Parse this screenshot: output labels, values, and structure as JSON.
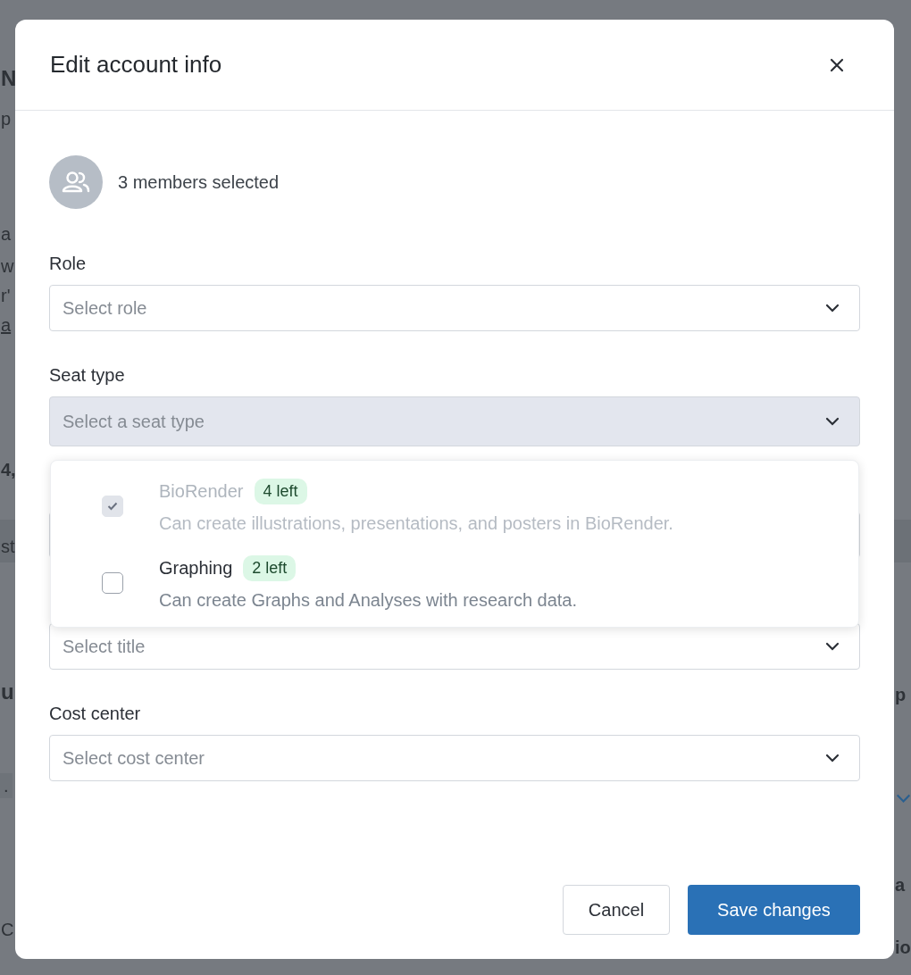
{
  "background": {
    "left": [
      {
        "text": "N",
        "kind": "heading"
      },
      {
        "text": "p",
        "kind": "text"
      },
      {
        "text": "a",
        "kind": "text"
      },
      {
        "text": "w",
        "kind": "text"
      },
      {
        "text": "r'",
        "kind": "text"
      },
      {
        "text": "a",
        "kind": "link"
      },
      {
        "text": "4,",
        "kind": "bold"
      },
      {
        "text": "st",
        "kind": "band"
      },
      {
        "text": "u",
        "kind": "heading"
      },
      {
        "text": ".",
        "kind": "chip"
      },
      {
        "text": "C",
        "kind": "text"
      }
    ],
    "right": [
      {
        "text": "p",
        "kind": "bold"
      },
      {
        "kind": "chevron"
      },
      {
        "text": "a",
        "kind": "bold"
      },
      {
        "text": "io",
        "kind": "bold"
      }
    ]
  },
  "modal": {
    "title": "Edit account info",
    "selection": "3 members selected",
    "fields": [
      {
        "label": "Role",
        "placeholder": "Select role",
        "open": false
      },
      {
        "label": "Seat type",
        "placeholder": "Select a seat type",
        "open": true
      },
      {
        "open": false
      },
      {
        "placeholder": "Select title",
        "open": false
      },
      {
        "label": "Cost center",
        "placeholder": "Select cost center",
        "open": false
      }
    ],
    "options": [
      {
        "title": "BioRender",
        "badge": "4 left",
        "description": "Can create illustrations, presentations, and posters in BioRender.",
        "checked": true,
        "disabled": true
      },
      {
        "title": "Graphing",
        "badge": "2 left",
        "description": "Can create Graphs and Analyses with research data.",
        "checked": false,
        "disabled": false
      }
    ],
    "buttons": [
      {
        "label": "Cancel",
        "kind": "secondary"
      },
      {
        "label": "Save changes",
        "kind": "primary"
      }
    ]
  }
}
